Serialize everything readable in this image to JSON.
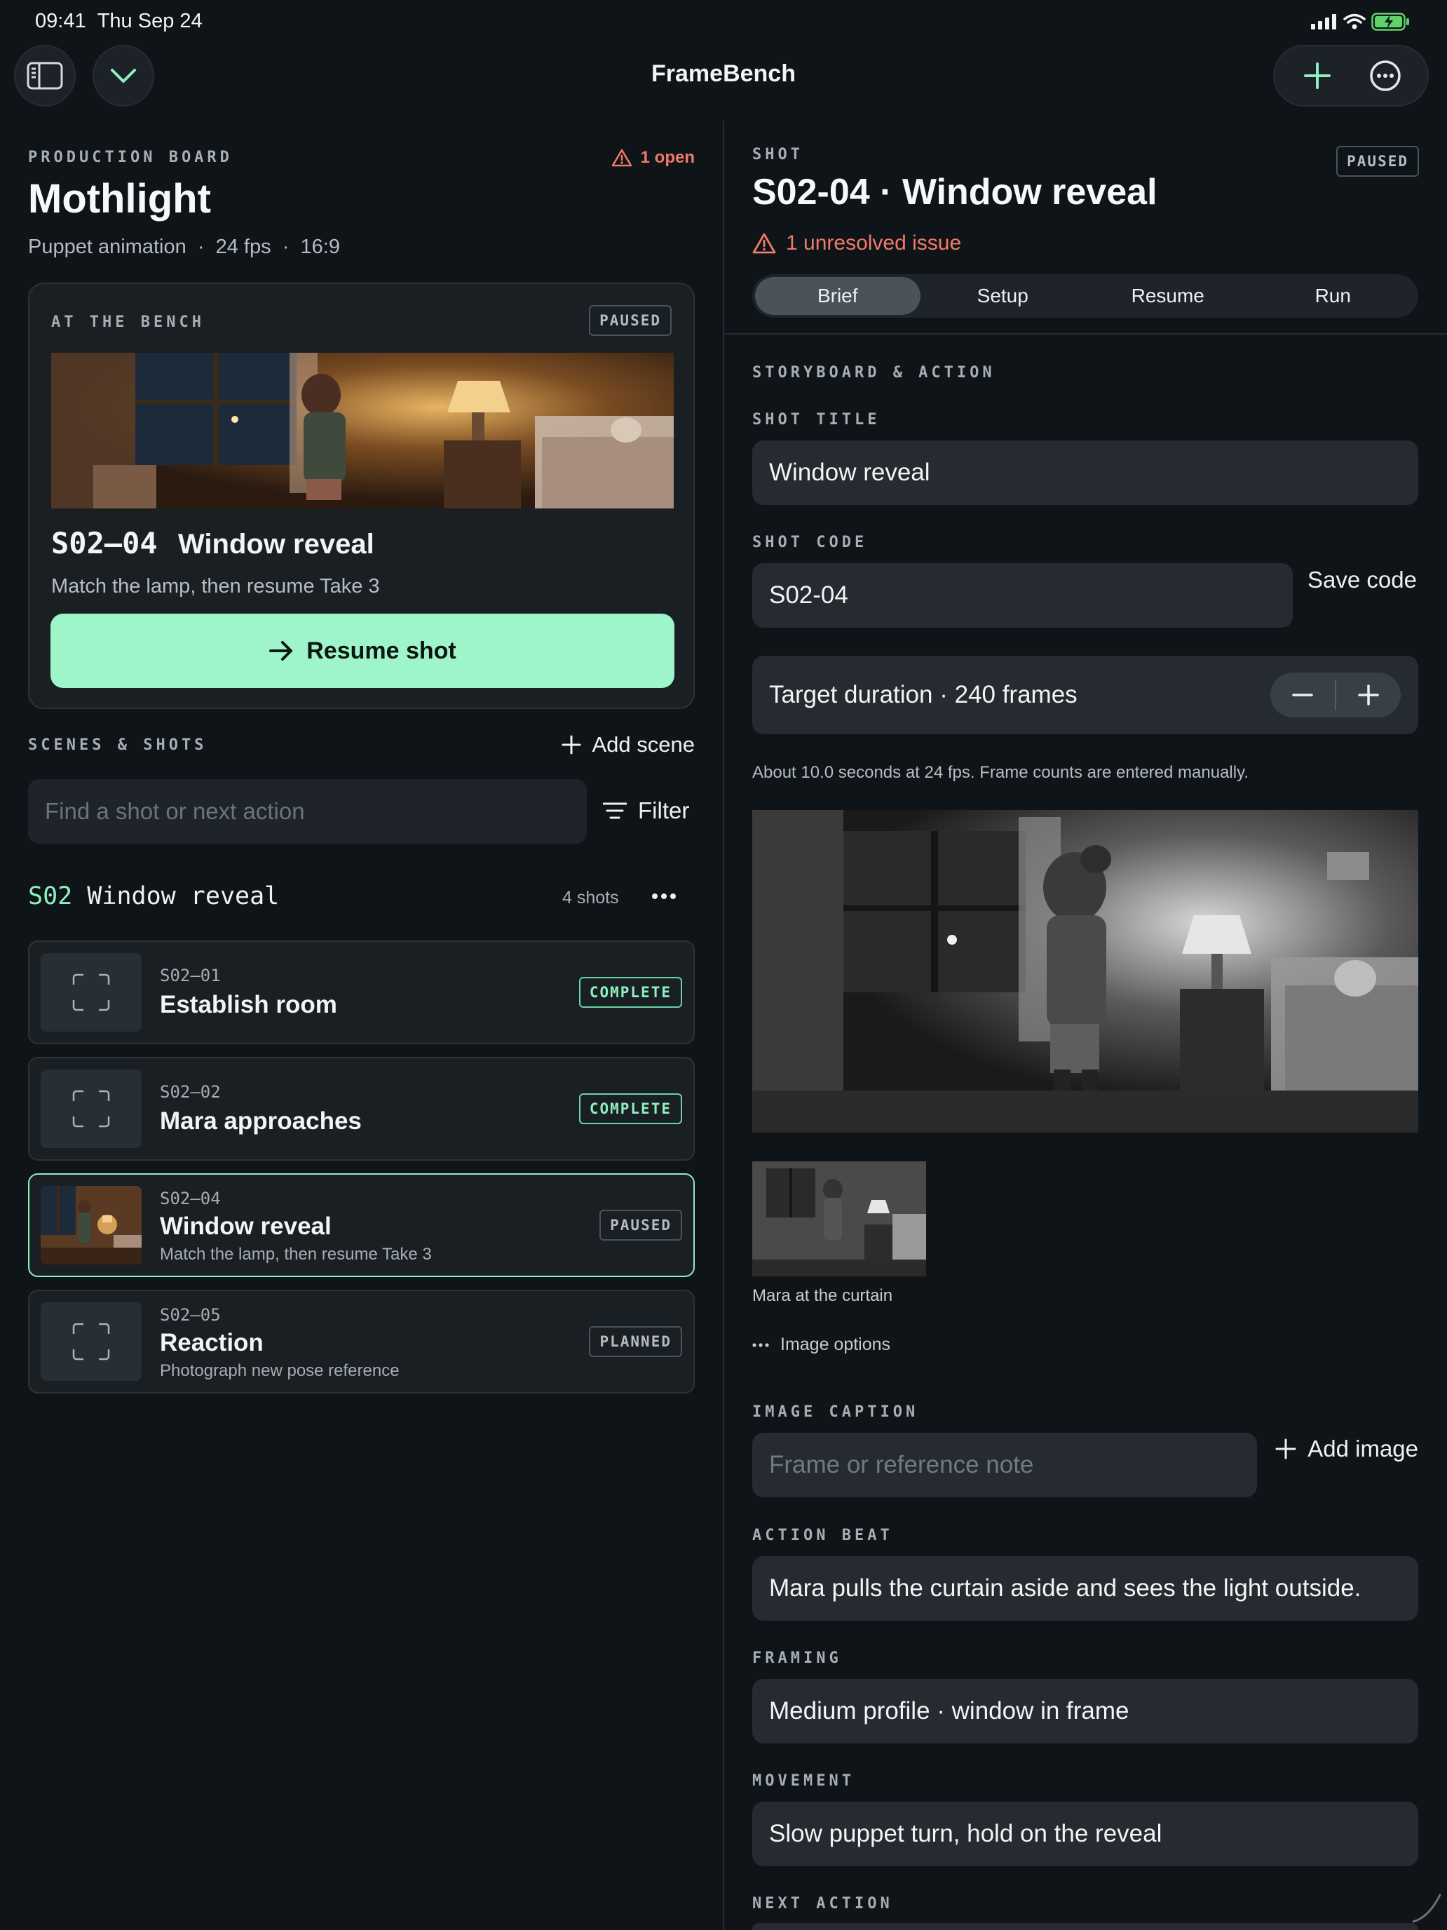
{
  "status_bar": {
    "time": "09:41",
    "date": "Thu Sep 24"
  },
  "app": {
    "title": "FrameBench"
  },
  "board": {
    "eyebrow": "PRODUCTION BOARD",
    "open_issues": "1 open",
    "project_title": "Mothlight",
    "meta": [
      "Puppet animation",
      "24 fps",
      "16:9"
    ]
  },
  "bench": {
    "eyebrow": "AT THE BENCH",
    "status": "PAUSED",
    "code": "S02–04",
    "name": "Window reveal",
    "desc": "Match the lamp, then resume Take 3",
    "resume_label": "Resume shot"
  },
  "scenes": {
    "eyebrow": "SCENES & SHOTS",
    "add_label": "Add scene",
    "search_placeholder": "Find a shot or next action",
    "filter_label": "Filter",
    "scene": {
      "code": "S02",
      "name": "Window reveal",
      "count": "4 shots"
    },
    "shots": [
      {
        "code": "S02–01",
        "name": "Establish room",
        "desc": "",
        "status": "COMPLETE"
      },
      {
        "code": "S02–02",
        "name": "Mara approaches",
        "desc": "",
        "status": "COMPLETE"
      },
      {
        "code": "S02–04",
        "name": "Window reveal",
        "desc": "Match the lamp, then resume Take 3",
        "status": "PAUSED"
      },
      {
        "code": "S02–05",
        "name": "Reaction",
        "desc": "Photograph new pose reference",
        "status": "PLANNED"
      }
    ]
  },
  "detail": {
    "eyebrow": "SHOT",
    "status": "PAUSED",
    "title": "S02-04 · Window reveal",
    "issue": "1 unresolved issue",
    "tabs": [
      "Brief",
      "Setup",
      "Resume",
      "Run"
    ],
    "selected_tab": "Brief",
    "section": "STORYBOARD & ACTION",
    "shot_title_label": "SHOT TITLE",
    "shot_title_value": "Window reveal",
    "shot_code_label": "SHOT CODE",
    "shot_code_value": "S02-04",
    "save_code_label": "Save code",
    "duration": "Target duration · 240 frames",
    "duration_note": "About 10.0 seconds at 24 fps. Frame counts are entered manually.",
    "thumb_caption": "Mara at the curtain",
    "image_options": "Image options",
    "caption_label": "IMAGE CAPTION",
    "caption_placeholder": "Frame or reference note",
    "add_image_label": "Add image",
    "action_label": "ACTION BEAT",
    "action_value": "Mara pulls the curtain aside and sees the light outside.",
    "framing_label": "FRAMING",
    "framing_value": "Medium profile · window in frame",
    "movement_label": "MOVEMENT",
    "movement_value": "Slow puppet turn, hold on the reveal",
    "next_label": "NEXT ACTION"
  },
  "colors": {
    "accent": "#8ef0c0",
    "warning": "#f07a68",
    "background": "#0f1418"
  }
}
